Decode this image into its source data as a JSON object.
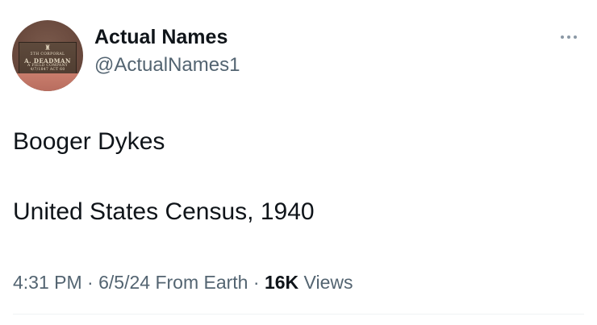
{
  "author": {
    "display_name": "Actual Names",
    "handle": "@ActualNames1",
    "avatar": {
      "plaque_line1": "5TH CORPORAL",
      "plaque_line2": "A. DEADMAN",
      "plaque_line3": "A FIELD COMPANY",
      "plaque_line4": "4/7/1847 ACT 60"
    }
  },
  "menu": {
    "icon": "more-horizontal-icon"
  },
  "tweet": {
    "lines": [
      "Booger Dykes",
      "United States Census, 1940"
    ]
  },
  "meta": {
    "time": "4:31 PM",
    "separator": "·",
    "date": "6/5/24",
    "source": "From Earth",
    "views_count": "16K",
    "views_label": "Views"
  },
  "colors": {
    "text_primary": "#0f1419",
    "text_secondary": "#536471",
    "divider": "#eff3f4"
  }
}
